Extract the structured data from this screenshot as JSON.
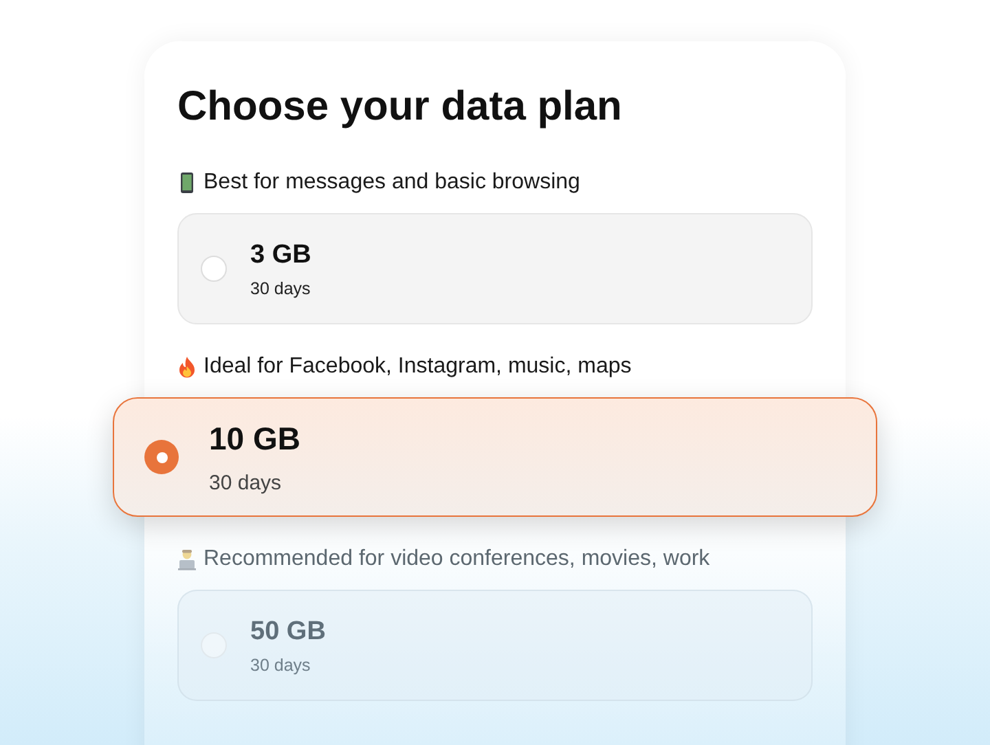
{
  "title": "Choose your data plan",
  "plans": [
    {
      "caption": "Best for messages and basic browsing",
      "name": "3 GB",
      "duration": "30 days",
      "selected": false
    },
    {
      "caption": "Ideal for Facebook, Instagram, music, maps",
      "name": "10 GB",
      "duration": "30 days",
      "selected": true
    },
    {
      "caption": "Recommended for video conferences, movies, work",
      "name": "50 GB",
      "duration": "30 days",
      "selected": false
    }
  ]
}
